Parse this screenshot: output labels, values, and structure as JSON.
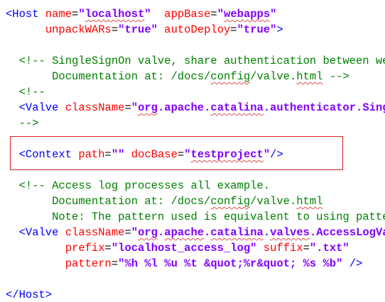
{
  "lines": [
    {
      "segments": [
        {
          "cls": "t",
          "text": "<Host "
        },
        {
          "cls": "a",
          "text": "name"
        },
        {
          "cls": "eq",
          "text": "="
        },
        {
          "cls": "v",
          "text": "\""
        },
        {
          "cls": "v sq",
          "text": "localhost"
        },
        {
          "cls": "v",
          "text": "\""
        },
        {
          "cls": "t",
          "text": "  "
        },
        {
          "cls": "a",
          "text": "appBase"
        },
        {
          "cls": "eq",
          "text": "="
        },
        {
          "cls": "v",
          "text": "\""
        },
        {
          "cls": "v sq",
          "text": "webapps"
        },
        {
          "cls": "v",
          "text": "\""
        }
      ]
    },
    {
      "segments": [
        {
          "cls": "t",
          "text": "      "
        },
        {
          "cls": "a",
          "text": "unpackWARs"
        },
        {
          "cls": "eq",
          "text": "="
        },
        {
          "cls": "v",
          "text": "\"true\""
        },
        {
          "cls": "t",
          "text": " "
        },
        {
          "cls": "a",
          "text": "autoDeploy"
        },
        {
          "cls": "eq",
          "text": "="
        },
        {
          "cls": "v",
          "text": "\"true\""
        },
        {
          "cls": "t",
          "text": ">"
        }
      ]
    },
    {
      "segments": []
    },
    {
      "segments": [
        {
          "cls": "c",
          "text": "  <!-- SingleSignOn valve, share authentication between web applications"
        }
      ]
    },
    {
      "segments": [
        {
          "cls": "c",
          "text": "       Documentation at: /docs/"
        },
        {
          "cls": "c sq",
          "text": "config"
        },
        {
          "cls": "c",
          "text": "/valve."
        },
        {
          "cls": "c sq",
          "text": "html"
        },
        {
          "cls": "c",
          "text": " -->"
        }
      ]
    },
    {
      "segments": [
        {
          "cls": "c",
          "text": "  <!--"
        }
      ]
    },
    {
      "segments": [
        {
          "cls": "t",
          "text": "  <Valve "
        },
        {
          "cls": "a",
          "text": "className"
        },
        {
          "cls": "eq",
          "text": "="
        },
        {
          "cls": "v",
          "text": "\""
        },
        {
          "cls": "v sq",
          "text": "org"
        },
        {
          "cls": "v",
          "text": ".apache."
        },
        {
          "cls": "v sq",
          "text": "catalina"
        },
        {
          "cls": "v",
          "text": ".authenticator.SingleSignOn\""
        }
      ]
    },
    {
      "segments": [
        {
          "cls": "c",
          "text": "  -->"
        }
      ]
    },
    {
      "segments": []
    },
    {
      "segments": [
        {
          "cls": "t",
          "text": "  <Context "
        },
        {
          "cls": "a",
          "text": "path"
        },
        {
          "cls": "eq",
          "text": "="
        },
        {
          "cls": "v",
          "text": "\"\""
        },
        {
          "cls": "t",
          "text": " "
        },
        {
          "cls": "a",
          "text": "docBase"
        },
        {
          "cls": "eq",
          "text": "="
        },
        {
          "cls": "v",
          "text": "\""
        },
        {
          "cls": "v sq",
          "text": "testproject"
        },
        {
          "cls": "v",
          "text": "\""
        },
        {
          "cls": "t",
          "text": "/>"
        }
      ]
    },
    {
      "segments": []
    },
    {
      "segments": [
        {
          "cls": "c",
          "text": "  <!-- Access log processes all example."
        }
      ]
    },
    {
      "segments": [
        {
          "cls": "c",
          "text": "       Documentation at: /docs/"
        },
        {
          "cls": "c sq",
          "text": "config"
        },
        {
          "cls": "c",
          "text": "/valve."
        },
        {
          "cls": "c sq",
          "text": "html"
        }
      ]
    },
    {
      "segments": [
        {
          "cls": "c",
          "text": "       Note: The pattern used is equivalent to using pattern=\"common\" -->"
        }
      ]
    },
    {
      "segments": [
        {
          "cls": "t",
          "text": "  <Valve "
        },
        {
          "cls": "a",
          "text": "className"
        },
        {
          "cls": "eq",
          "text": "="
        },
        {
          "cls": "v",
          "text": "\""
        },
        {
          "cls": "v sq",
          "text": "org"
        },
        {
          "cls": "v",
          "text": "."
        },
        {
          "cls": "v sq",
          "text": "apache"
        },
        {
          "cls": "v",
          "text": "."
        },
        {
          "cls": "v sq",
          "text": "catalina"
        },
        {
          "cls": "v",
          "text": "."
        },
        {
          "cls": "v sq",
          "text": "valves"
        },
        {
          "cls": "v",
          "text": ".AccessLogValve\""
        }
      ]
    },
    {
      "segments": [
        {
          "cls": "t",
          "text": "         "
        },
        {
          "cls": "a",
          "text": "prefix"
        },
        {
          "cls": "eq",
          "text": "="
        },
        {
          "cls": "v",
          "text": "\"localhost_access_log\""
        },
        {
          "cls": "t",
          "text": " "
        },
        {
          "cls": "a",
          "text": "suffix"
        },
        {
          "cls": "eq",
          "text": "="
        },
        {
          "cls": "v",
          "text": "\".txt\""
        }
      ]
    },
    {
      "segments": [
        {
          "cls": "t",
          "text": "         "
        },
        {
          "cls": "a",
          "text": "pattern"
        },
        {
          "cls": "eq",
          "text": "="
        },
        {
          "cls": "v",
          "text": "\"%h %l %u %t &quot;%r&quot; %s %b\""
        },
        {
          "cls": "t",
          "text": " />"
        }
      ]
    },
    {
      "segments": []
    },
    {
      "segments": [
        {
          "cls": "t",
          "text": "</Host>"
        }
      ]
    }
  ]
}
